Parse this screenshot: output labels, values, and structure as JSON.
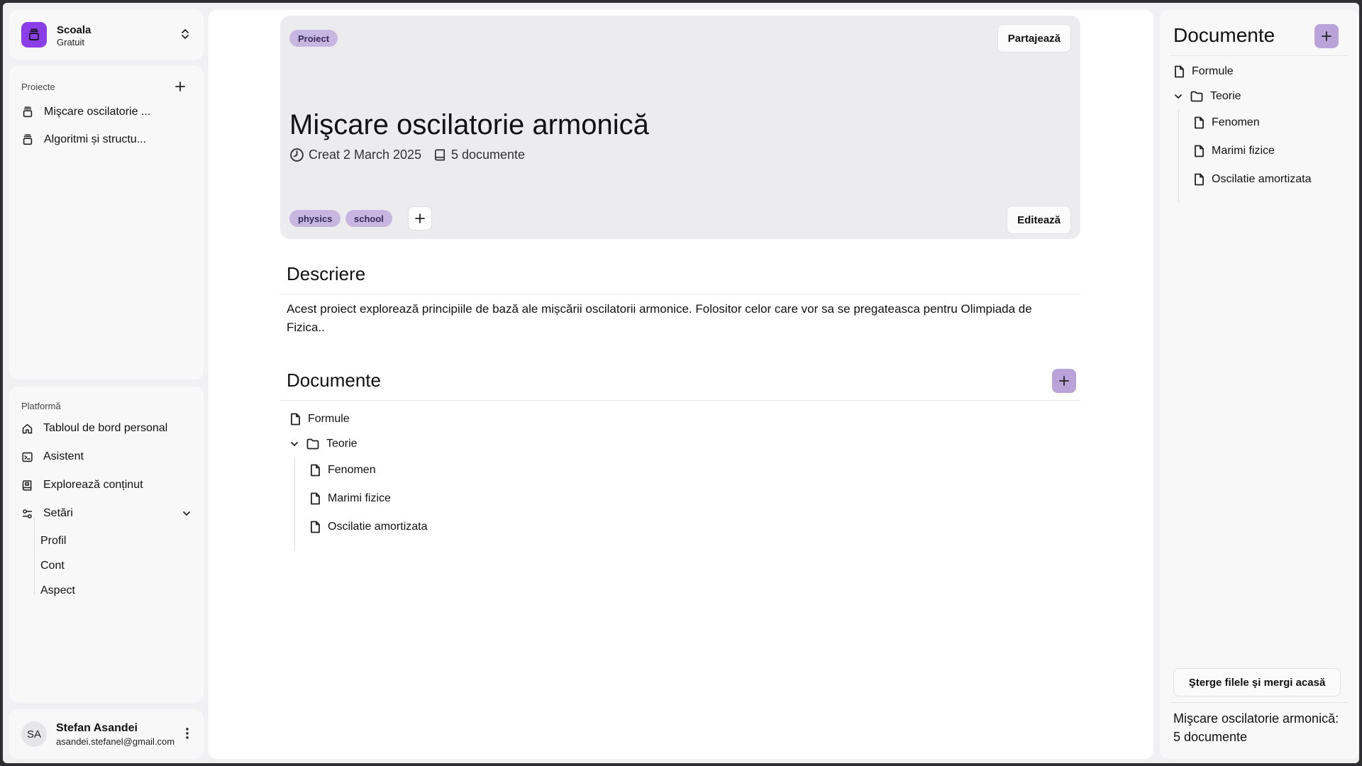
{
  "workspace": {
    "name": "Scoala",
    "plan": "Gratuit"
  },
  "sidebar": {
    "projects_label": "Proiecte",
    "projects": [
      {
        "label": "Mişcare oscilatorie ..."
      },
      {
        "label": "Algoritmi și structu..."
      }
    ],
    "platform_label": "Platformă",
    "platform": [
      {
        "label": "Tabloul de bord personal",
        "icon": "home-icon"
      },
      {
        "label": "Asistent",
        "icon": "terminal-icon"
      },
      {
        "label": "Explorează conținut",
        "icon": "book-icon"
      },
      {
        "label": "Setări",
        "icon": "settings-icon"
      }
    ],
    "settings_sub": [
      {
        "label": "Profil"
      },
      {
        "label": "Cont"
      },
      {
        "label": "Aspect"
      }
    ]
  },
  "user": {
    "initials": "SA",
    "name": "Stefan Asandei",
    "email": "asandei.stefanel@gmail.com"
  },
  "hero": {
    "badge": "Proiect",
    "share_label": "Partajează",
    "title": "Mişcare oscilatorie armonică",
    "created": "Creat 2 March 2025",
    "documents_count": "5 documente",
    "tags": [
      "physics",
      "school"
    ],
    "edit_label": "Editează"
  },
  "description": {
    "heading": "Descriere",
    "text": "Acest proiect explorează principiile de bază ale mișcării oscilatorii armonice. Folositor celor care vor sa se pregateasca pentru Olimpiada de Fizica.."
  },
  "documents": {
    "heading": "Documente",
    "root_file": "Formule",
    "folder": "Teorie",
    "children": [
      "Fenomen",
      "Marimi fizice",
      "Oscilatie amortizata"
    ]
  },
  "right_panel": {
    "title": "Documente",
    "root_file": "Formule",
    "folder": "Teorie",
    "children": [
      "Fenomen",
      "Marimi fizice",
      "Oscilatie amortizata"
    ],
    "delete_label": "Şterge filele şi mergi acasă",
    "summary": "Mişcare oscilatorie armonică: 5 documente"
  },
  "colors": {
    "accent": "#8b3de8",
    "tag_bg": "#c6b6e0",
    "add_button": "#b9a3d8"
  }
}
